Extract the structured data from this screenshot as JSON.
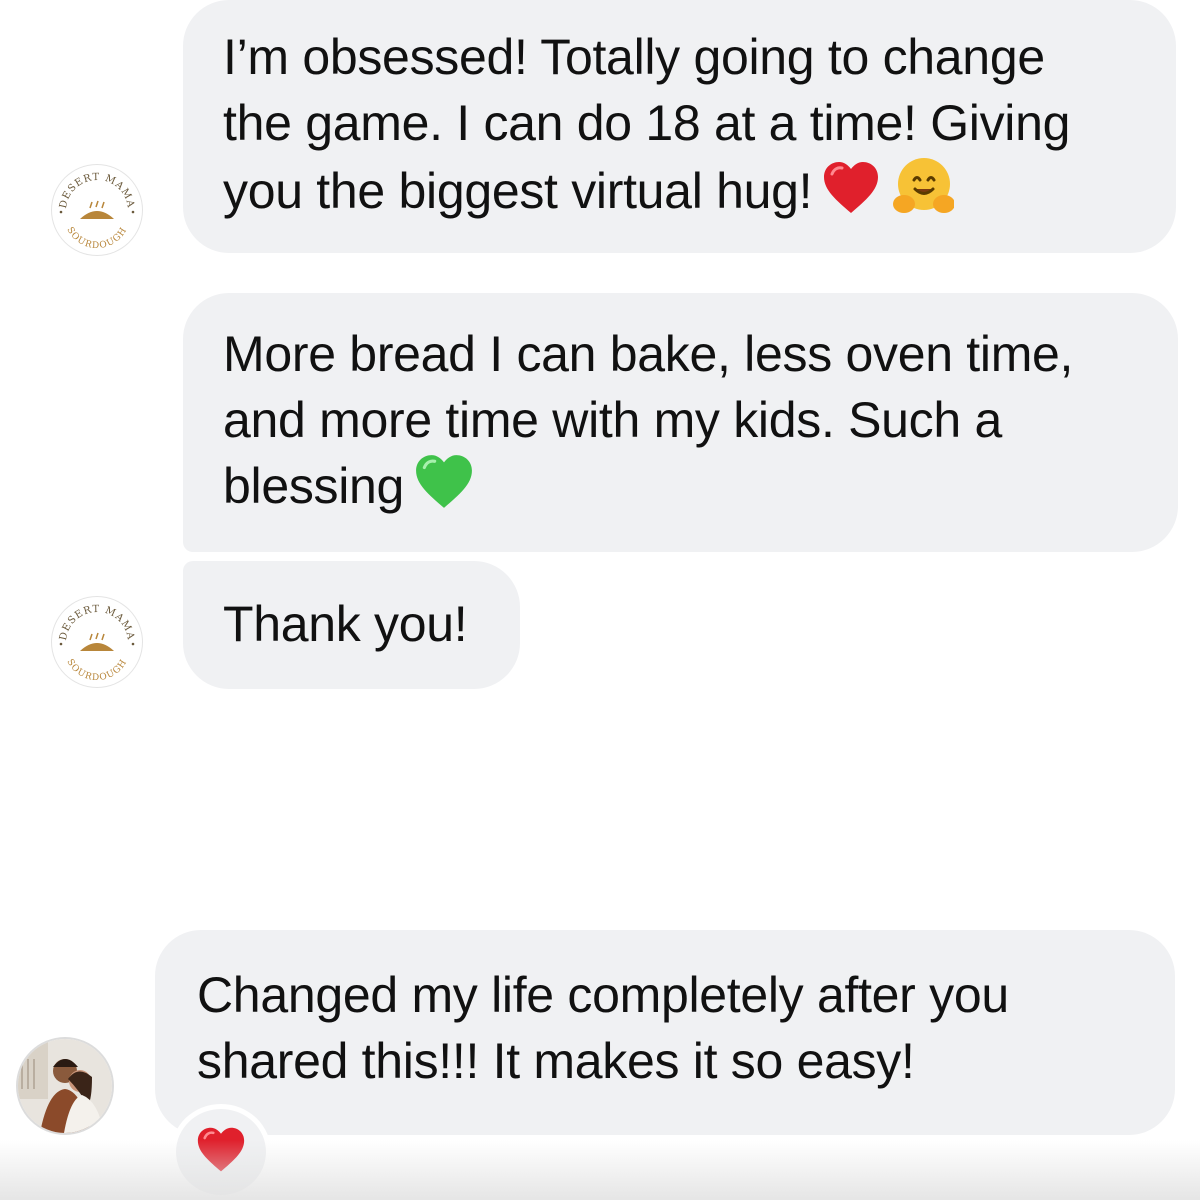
{
  "messages": [
    {
      "sender": "desert-mama-sourdough",
      "lines": [
        "I’m obsessed! Totally going to change",
        "the game. I can do 18 at a time! Giving",
        "you the biggest virtual hug!"
      ],
      "emojis": [
        "red-heart-icon",
        "hugging-face-icon"
      ]
    },
    {
      "sender": "desert-mama-sourdough",
      "lines": [
        "More bread I can bake, less oven time,",
        "and more time with my kids. Such a",
        "blessing"
      ],
      "emojis": [
        "green-heart-icon"
      ]
    },
    {
      "sender": "desert-mama-sourdough",
      "lines": [
        "Thank you!"
      ]
    },
    {
      "sender": "customer",
      "lines": [
        "Changed my life completely after you",
        "shared this!!! It makes it so easy!"
      ],
      "reaction": "red-heart-icon"
    }
  ],
  "avatar_logo": {
    "top_text": "DESERT MAMA",
    "bottom_text": "SOURDOUGH",
    "color": "#b8863a"
  },
  "colors": {
    "bubble_bg": "#f0f1f3",
    "text": "#111111",
    "red_heart": "#e0202c",
    "green_heart": "#3fc24a",
    "hug_yellow": "#f7c236"
  }
}
